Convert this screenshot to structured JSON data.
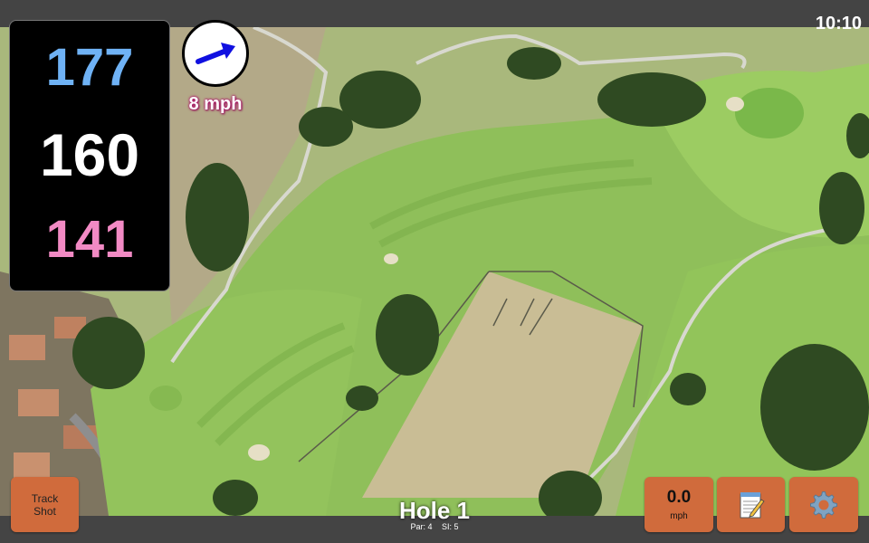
{
  "status": {
    "time": "10:10"
  },
  "distances": {
    "back": "177",
    "middle": "160",
    "front": "141"
  },
  "wind": {
    "speed_text": "8 mph",
    "direction_icon": "arrow-icon",
    "arrow_color": "#1010e0"
  },
  "hole": {
    "title": "Hole 1",
    "par_label": "Par: 4",
    "si_label": "SI: 5"
  },
  "buttons": {
    "track_shot_line1": "Track",
    "track_shot_line2": "Shot",
    "speed_value": "0.0",
    "speed_unit": "mph",
    "notes_icon": "notepad-icon",
    "settings_icon": "gear-icon"
  },
  "colors": {
    "back_distance": "#6fb2f5",
    "middle_distance": "#ffffff",
    "front_distance": "#f28ac4",
    "button": "#d06b3c",
    "fairway": "#8fbf5a"
  }
}
